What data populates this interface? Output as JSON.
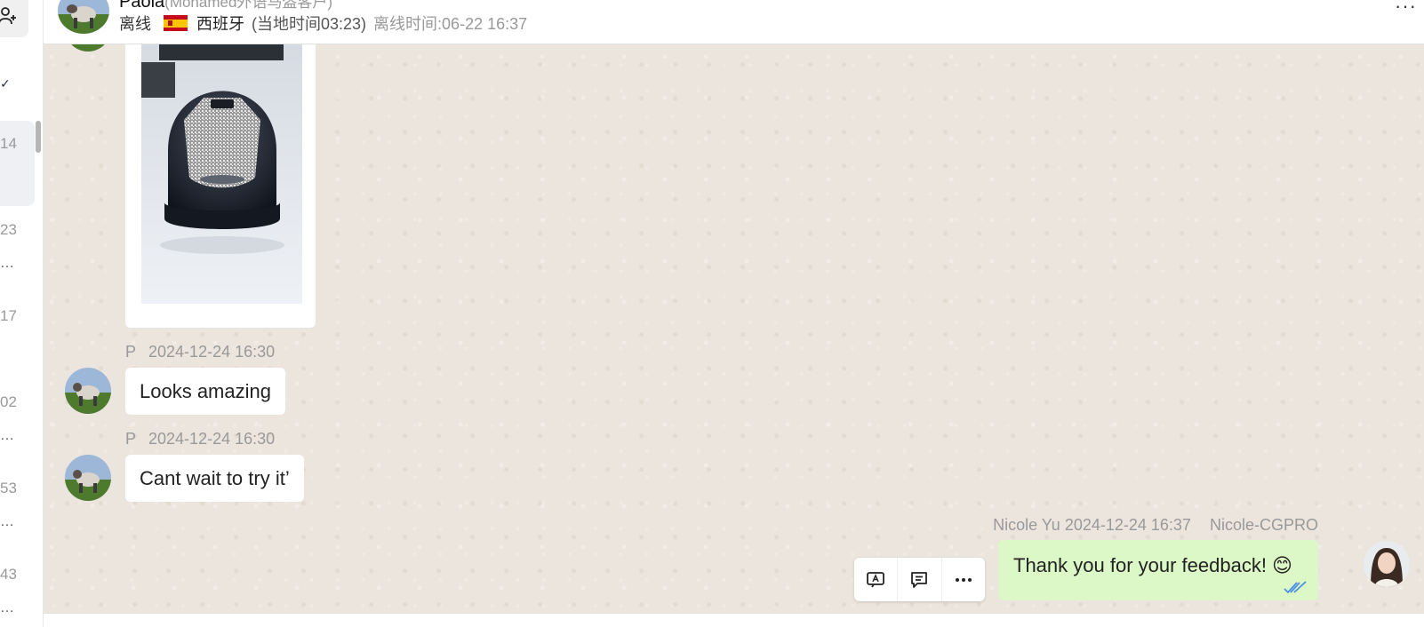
{
  "sidebar": {
    "times": [
      "14",
      "23",
      "17",
      "02",
      "53",
      "43"
    ],
    "ellipsis": "…"
  },
  "header": {
    "contact_name": "Paola",
    "contact_subtitle": "(Mohamed外语马盔客户)",
    "status": "离线",
    "country": "西班牙",
    "local_time": "(当地时间03:23)",
    "last_seen": "离线时间:06-22 16:37",
    "more_glyph": "···"
  },
  "messages": [
    {
      "sender": "P",
      "timestamp": "2024-12-24 16:30",
      "text": "Looks amazing"
    },
    {
      "sender": "P",
      "timestamp": "2024-12-24 16:30",
      "text": "Cant wait to try it’"
    }
  ],
  "outgoing": {
    "sender": "Nicole Yu",
    "timestamp": "2024-12-24 16:37",
    "agent": "Nicole-CGPRO",
    "text": "Thank you for your feedback! 😊"
  },
  "colors": {
    "chat_background": "#ece5dd",
    "outgoing_bubble": "#dcf8c6",
    "read_ticks": "#4a90e2"
  }
}
